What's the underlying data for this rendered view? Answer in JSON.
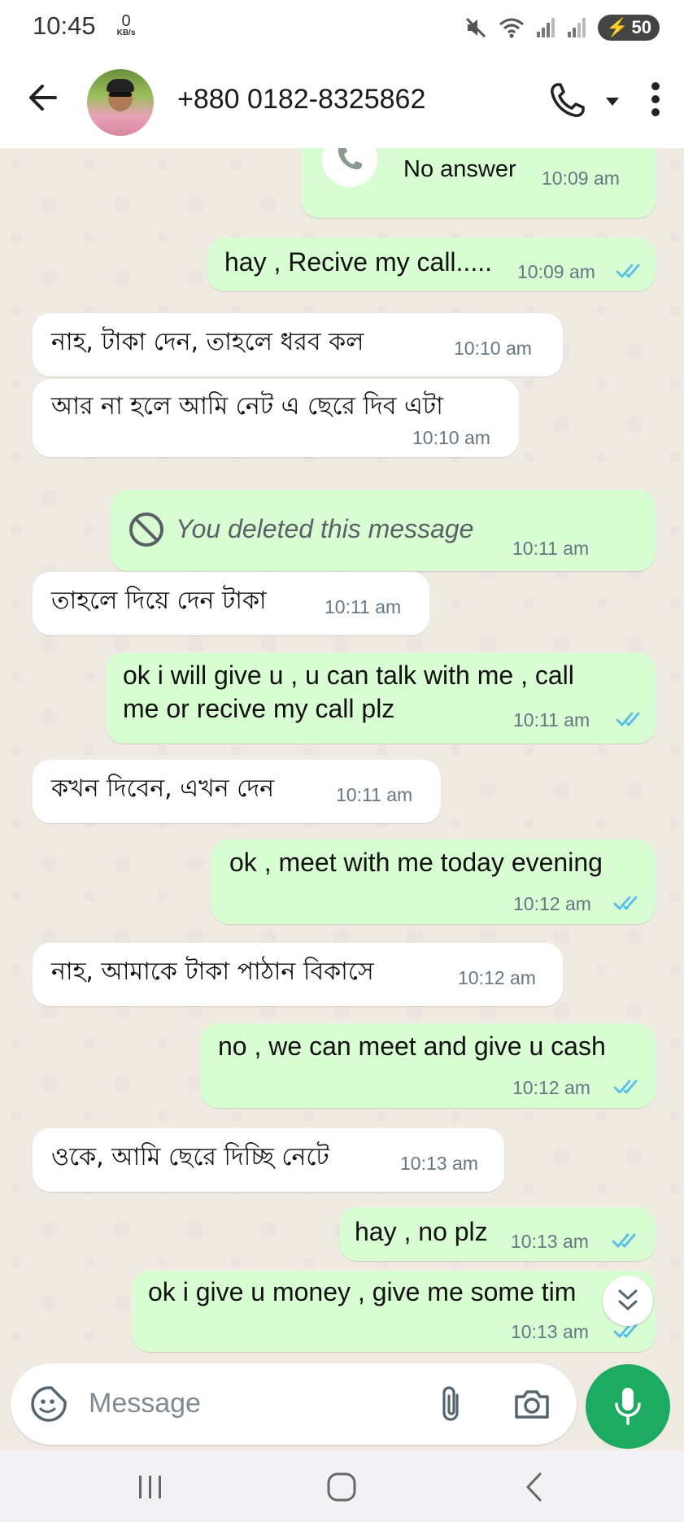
{
  "status_bar": {
    "time": "10:45",
    "net_speed_value": "0",
    "net_speed_unit": "KB/s",
    "battery": "50"
  },
  "header": {
    "contact": "+880 0182-8325862"
  },
  "messages": [
    {
      "dir": "out",
      "type": "call",
      "text": "No answer",
      "time": "10:09 am"
    },
    {
      "dir": "out",
      "text": "hay , Recive my call.....",
      "time": "10:09 am",
      "status": "read"
    },
    {
      "dir": "in",
      "text": "নাহ,  টাকা দেন,  তাহলে ধরব কল",
      "time": "10:10 am"
    },
    {
      "dir": "in",
      "text": "আর না হলে আমি নেট এ ছেরে দিব এটা",
      "time": "10:10 am"
    },
    {
      "dir": "out",
      "type": "deleted",
      "text": "You deleted this message",
      "time": "10:11 am"
    },
    {
      "dir": "in",
      "text": "তাহলে দিয়ে দেন টাকা",
      "time": "10:11 am"
    },
    {
      "dir": "out",
      "lines": [
        "ok i will give u , u can talk with me , call",
        "me or recive my call plz"
      ],
      "time": "10:11 am",
      "status": "read"
    },
    {
      "dir": "in",
      "text": "কখন দিবেন, এখন দেন",
      "time": "10:11 am"
    },
    {
      "dir": "out",
      "text": "ok , meet with me today evening",
      "time": "10:12 am",
      "status": "read"
    },
    {
      "dir": "in",
      "text": "নাহ,  আমাকে টাকা পাঠান বিকাসে",
      "time": "10:12 am"
    },
    {
      "dir": "out",
      "text": "no , we can meet and give u cash",
      "time": "10:12 am",
      "status": "read"
    },
    {
      "dir": "in",
      "text": "ওকে,  আমি ছেরে দিচ্ছি নেটে",
      "time": "10:13 am"
    },
    {
      "dir": "out",
      "text": "hay , no plz",
      "time": "10:13 am",
      "status": "read"
    },
    {
      "dir": "out",
      "text": "ok i give u money , give me some tim",
      "time": "10:13 am",
      "status": "read"
    }
  ],
  "composer": {
    "placeholder": "Message"
  },
  "colors": {
    "outgoing_bubble": "#d9fdd3",
    "incoming_bubble": "#ffffff",
    "read_tick": "#53bdeb",
    "mic_button": "#1daa61",
    "chat_background": "#efeae2"
  }
}
